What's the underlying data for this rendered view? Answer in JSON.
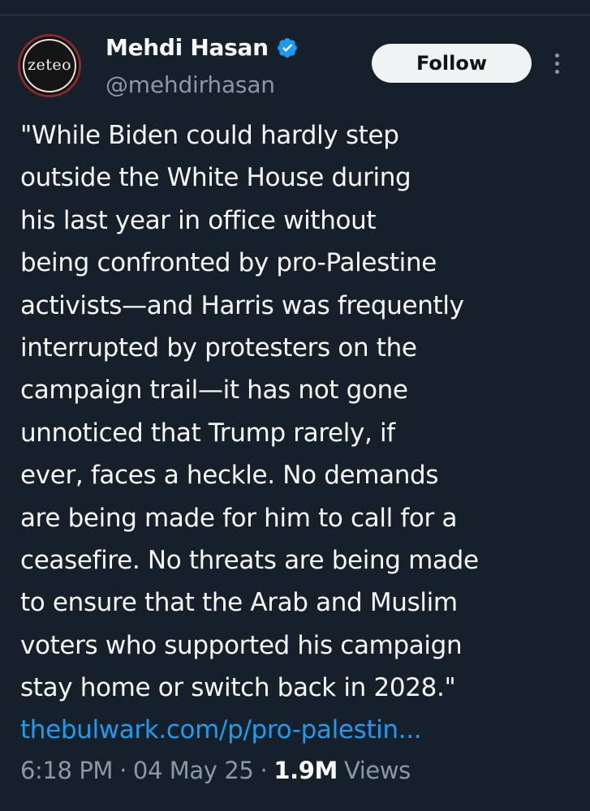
{
  "author": {
    "avatar_text": "zeteo",
    "display_name": "Mehdi Hasan",
    "verified_icon": "verified-badge-icon",
    "handle": "@mehdirhasan"
  },
  "actions": {
    "follow_label": "Follow",
    "more_icon": "more-options-icon"
  },
  "tweet": {
    "lines": [
      "\"While Biden could hardly step",
      "outside the White House during",
      "his last year in office without",
      "being confronted by pro-Palestine",
      "activists—and Harris was frequently",
      "interrupted by protesters on the",
      "campaign trail—it has not gone",
      "unnoticed that Trump rarely, if",
      "ever, faces a heckle. No demands",
      "are being made for him to call for a",
      "ceasefire. No threats are being made",
      "to ensure that the Arab and Muslim",
      "voters who supported his campaign",
      "stay home or switch back in 2028.\""
    ],
    "link_text": "thebulwark.com/p/pro-palestin..."
  },
  "meta": {
    "time": "6:18 PM",
    "separator": "·",
    "date": "04 May 25",
    "views_count": "1.9M",
    "views_label": "Views"
  },
  "colors": {
    "background": "#15202b",
    "primary_text": "#f7f9f9",
    "secondary_text": "#8b98a5",
    "link": "#1d9bf0",
    "verified": "#1d9bf0",
    "follow_button_bg": "#eff3f4"
  }
}
